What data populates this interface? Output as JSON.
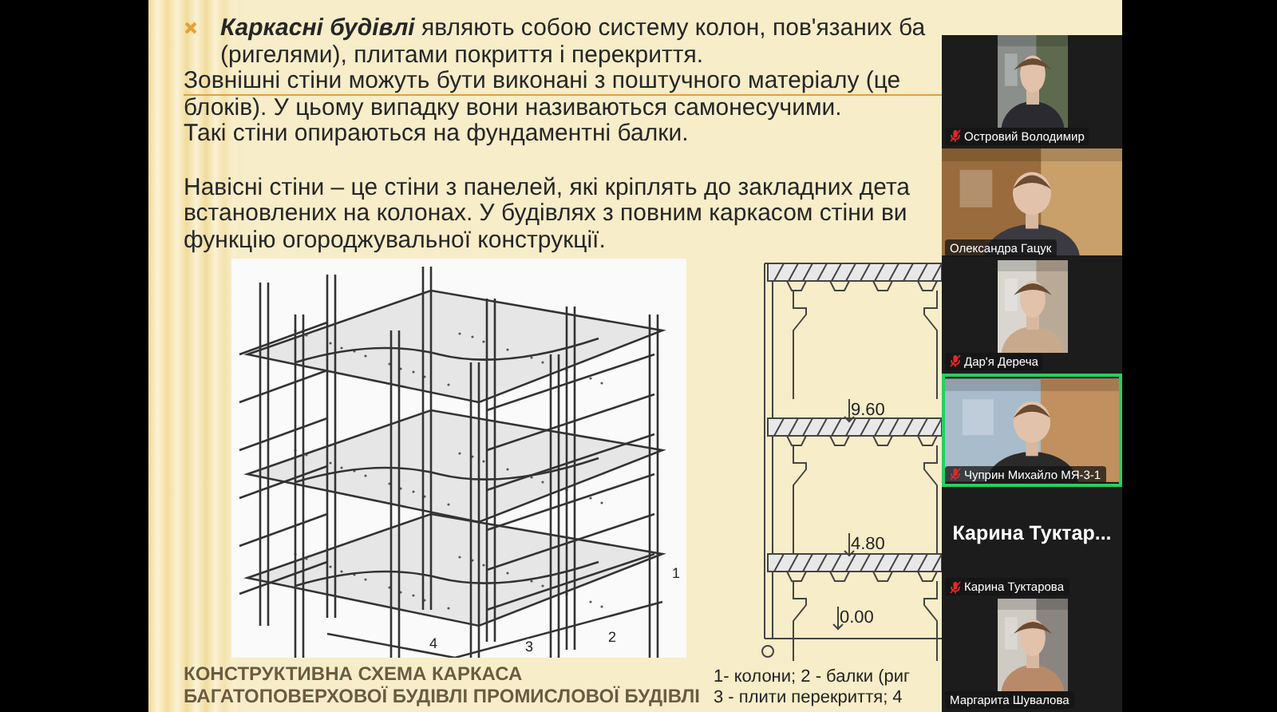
{
  "slide": {
    "paragraphs": [
      {
        "lines": [
          {
            "kind": "bullet",
            "text": "**Каркасні будівлі** являють собою систему колон, пов'язаних ба",
            "underlined": false
          },
          {
            "kind": "indent",
            "text": "(ригелями), плитами покриття і перекриття.",
            "underlined": false
          },
          {
            "kind": "plain",
            "text": "Зовнішні стіни можуть бути виконані з поштучного матеріалу (це",
            "underlined": true
          },
          {
            "kind": "plain",
            "text": "блоків). У цьому випадку вони називаються самонесучими.",
            "underlined": false
          },
          {
            "kind": "plain",
            "text": "Такі стіни опираються на фундаментні балки.",
            "underlined": false
          }
        ]
      },
      {
        "lines": [
          {
            "kind": "plain",
            "text": "Навісні стіни – це стіни з панелей, які кріплять до закладних дета",
            "underlined": false
          },
          {
            "kind": "plain",
            "text": "встановлених на колонах. У будівлях з повним каркасом стіни ви",
            "underlined": false
          },
          {
            "kind": "plain",
            "text": "функцію огороджувальної конструкції.",
            "underlined": false
          }
        ]
      }
    ],
    "left_figure": {
      "labels": [
        "4",
        "3",
        "2",
        "1"
      ]
    },
    "right_figure": {
      "levels": [
        "9.60",
        "4.80",
        "0.00"
      ]
    },
    "caption": [
      "КОНСТРУКТИВНА СХЕМА КАРКАСА",
      "БАГАТОПОВЕРХОВОЇ БУДІВЛІ ПРОМИСЛОВОЇ БУДІВЛІ"
    ],
    "legend": [
      "1- колони; 2 - балки (риг",
      "3 - плити перекриття; 4"
    ]
  },
  "participants": [
    {
      "name": "Островий Володимир",
      "kind": "portrait-video",
      "muted": true,
      "speaking": false
    },
    {
      "name": "Олександра Гацук",
      "kind": "wide-video",
      "muted": false,
      "speaking": false
    },
    {
      "name": "Дар'я Деречa",
      "kind": "portrait-video",
      "muted": true,
      "speaking": false
    },
    {
      "name": "Чуприн Михайло МЯ-3-1",
      "kind": "wide-video",
      "muted": true,
      "speaking": true
    },
    {
      "name": "Карина Туктарова",
      "kind": "name-only",
      "display_name": "Карина  Туктар...",
      "muted": true,
      "speaking": false
    },
    {
      "name": "Маргарита Шувалова",
      "kind": "portrait-video",
      "muted": false,
      "speaking": false
    }
  ]
}
